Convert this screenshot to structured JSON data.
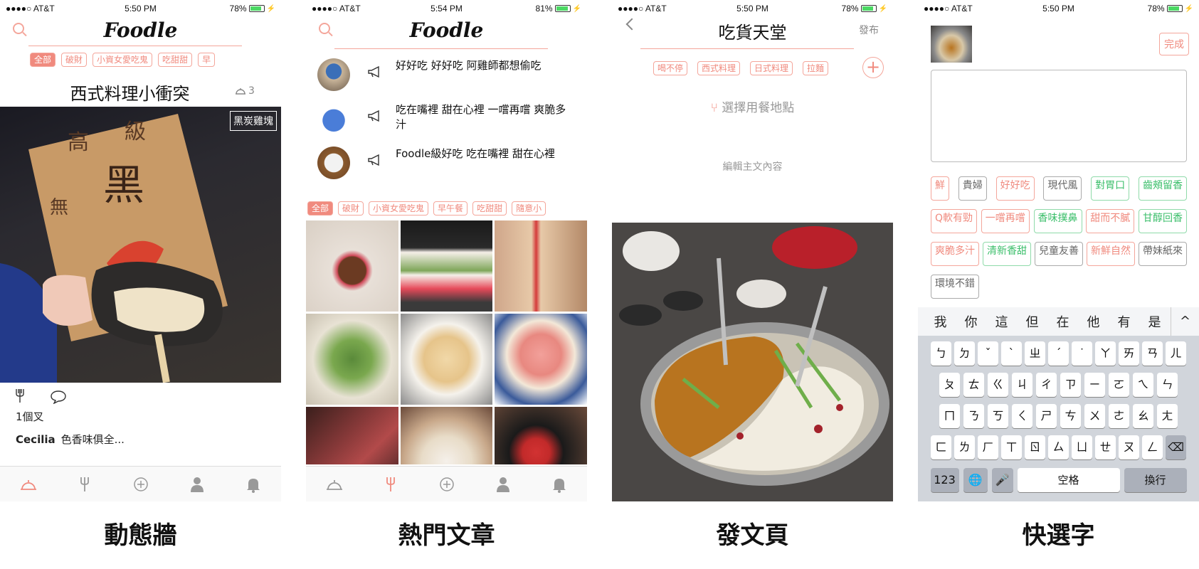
{
  "colors": {
    "accent": "#f08a7e",
    "accent_light": "#f4a69b",
    "green": "#3cbf6b",
    "battery": "#4cd964"
  },
  "screens": [
    {
      "status": {
        "carrier": "●●●●○ AT&T",
        "time": "5:50 PM",
        "battery": "78%",
        "battery_level": 0.78
      },
      "brand": "Foodle",
      "chips": [
        "全部",
        "破財",
        "小資女愛吃鬼",
        "吃甜甜",
        "早"
      ],
      "post_title": "西式料理小衝突",
      "post_count": "3",
      "photo_sign": "黑炭雞塊",
      "forks": "1個叉",
      "author": "Cecilia",
      "comment": "色香味俱全...",
      "caption": "動態牆"
    },
    {
      "status": {
        "carrier": "●●●●○ AT&T",
        "time": "5:54 PM",
        "battery": "81%",
        "battery_level": 0.81
      },
      "brand": "Foodle",
      "feed": [
        {
          "text": "好好吃 好好吃 阿雞師都想偷吃"
        },
        {
          "text": "吃在嘴裡 甜在心裡 一嚐再嚐 爽脆多汁"
        },
        {
          "text": "Foodle級好吃 吃在嘴裡 甜在心裡"
        }
      ],
      "chips": [
        "全部",
        "破財",
        "小資女愛吃鬼",
        "早午餐",
        "吃甜甜",
        "隨意小"
      ],
      "caption": "熱門文章"
    },
    {
      "status": {
        "carrier": "●●●●○ AT&T",
        "time": "5:50 PM",
        "battery": "78%",
        "battery_level": 0.78
      },
      "title": "吃貨天堂",
      "publish": "發布",
      "chips": [
        "喝不停",
        "西式料理",
        "日式料理",
        "拉麵"
      ],
      "location": "選擇用餐地點",
      "edit_hint": "編輯主文內容",
      "caption": "發文頁"
    },
    {
      "status": {
        "carrier": "●●●●○ AT&T",
        "time": "5:50 PM",
        "battery": "78%",
        "battery_level": 0.78
      },
      "done": "完成",
      "tags": [
        "鮮",
        "貴婦",
        "好好吃",
        "現代風",
        "對胃口",
        "齒頰留香",
        "Q軟有勁",
        "一嚐再嚐",
        "香味撲鼻",
        "甜而不膩",
        "甘醇回香",
        "爽脆多汁",
        "清新香甜",
        "兒童友善",
        "新鮮自然",
        "帶妹紙來",
        "環境不錯"
      ],
      "candidates": [
        "我",
        "你",
        "這",
        "但",
        "在",
        "他",
        "有",
        "是"
      ],
      "kb_rows": [
        [
          "ㄅ",
          "ㄉ",
          "ˇ",
          "ˋ",
          "ㄓ",
          "ˊ",
          "˙",
          "ㄚ",
          "ㄞ",
          "ㄢ",
          "ㄦ"
        ],
        [
          "ㄆ",
          "ㄊ",
          "ㄍ",
          "ㄐ",
          "ㄔ",
          "ㄗ",
          "ㄧ",
          "ㄛ",
          "ㄟ",
          "ㄣ"
        ],
        [
          "ㄇ",
          "ㄋ",
          "ㄎ",
          "ㄑ",
          "ㄕ",
          "ㄘ",
          "ㄨ",
          "ㄜ",
          "ㄠ",
          "ㄤ"
        ],
        [
          "ㄈ",
          "ㄌ",
          "ㄏ",
          "ㄒ",
          "ㄖ",
          "ㄙ",
          "ㄩ",
          "ㄝ",
          "ㄡ",
          "ㄥ"
        ]
      ],
      "kb_bottom": {
        "num": "123",
        "space": "空格",
        "ret": "換行"
      },
      "caption": "快選字"
    }
  ]
}
